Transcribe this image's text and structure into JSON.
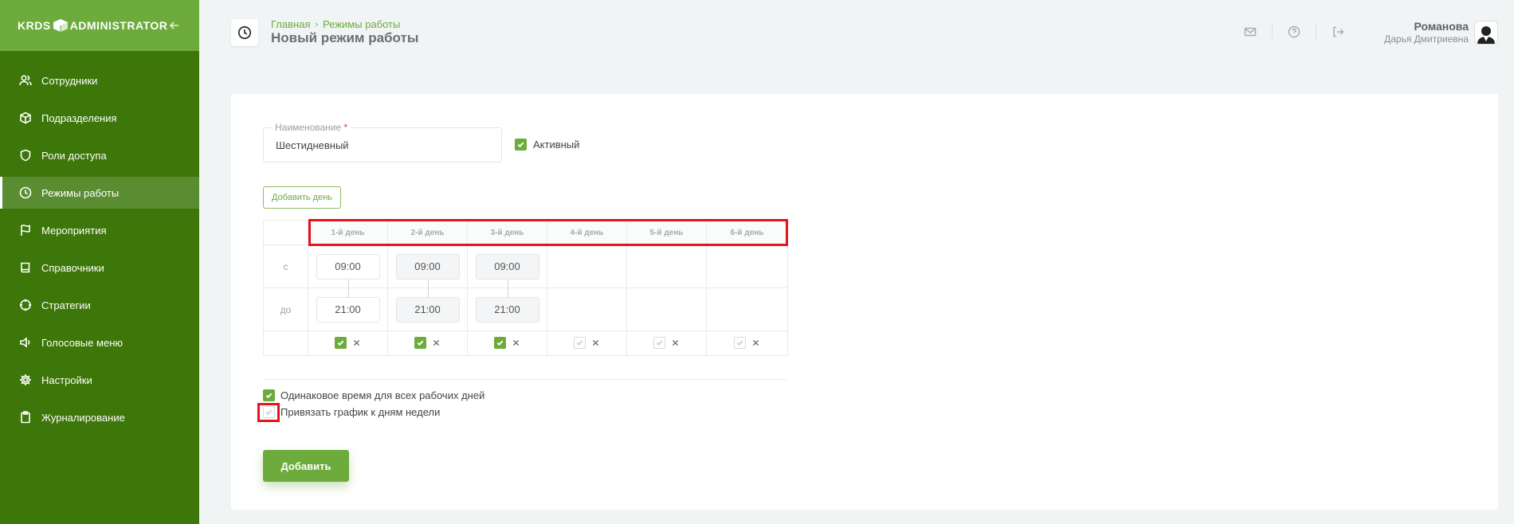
{
  "brand": {
    "logo_left": "KRDS",
    "logo_right": "ADMINISTRATOR"
  },
  "sidebar": {
    "items": [
      {
        "label": "Сотрудники",
        "icon": "users-icon",
        "active": false
      },
      {
        "label": "Подразделения",
        "icon": "cube-icon",
        "active": false
      },
      {
        "label": "Роли доступа",
        "icon": "shield-icon",
        "active": false
      },
      {
        "label": "Режимы работы",
        "icon": "clock-icon",
        "active": true
      },
      {
        "label": "Мероприятия",
        "icon": "flag-icon",
        "active": false
      },
      {
        "label": "Справочники",
        "icon": "book-icon",
        "active": false
      },
      {
        "label": "Стратегии",
        "icon": "crosshair-icon",
        "active": false
      },
      {
        "label": "Голосовые меню",
        "icon": "speaker-icon",
        "active": false
      },
      {
        "label": "Настройки",
        "icon": "gear-icon",
        "active": false
      },
      {
        "label": "Журналирование",
        "icon": "clipboard-icon",
        "active": false
      }
    ]
  },
  "header": {
    "breadcrumb": [
      "Главная",
      "Режимы работы"
    ],
    "title": "Новый режим работы",
    "user": {
      "last_name": "Романова",
      "full_name": "Дарья Дмитриевна"
    }
  },
  "form": {
    "name_label": "Наименование",
    "name_required_mark": "*",
    "name_value": "Шестидневный",
    "active_label": "Активный",
    "active_checked": true,
    "add_day_label": "Добавить день",
    "row_from_label": "с",
    "row_to_label": "до",
    "days": [
      {
        "label": "1-й день",
        "from": "09:00",
        "to": "21:00",
        "working": true
      },
      {
        "label": "2-й день",
        "from": "09:00",
        "to": "21:00",
        "working": true
      },
      {
        "label": "3-й день",
        "from": "09:00",
        "to": "21:00",
        "working": true
      },
      {
        "label": "4-й день",
        "from": "",
        "to": "",
        "working": false
      },
      {
        "label": "5-й день",
        "from": "",
        "to": "",
        "working": false
      },
      {
        "label": "6-й день",
        "from": "",
        "to": "",
        "working": false
      }
    ],
    "same_time_label": "Одинаковое время для всех рабочих дней",
    "same_time_checked": true,
    "bind_weekdays_label": "Привязать график к дням недели",
    "bind_weekdays_checked": false,
    "submit_label": "Добавить"
  },
  "colors": {
    "sidebar": "#3d7609",
    "brand_bar": "#6cab3c",
    "accent": "#6cab3c",
    "highlight": "#e5141c"
  }
}
